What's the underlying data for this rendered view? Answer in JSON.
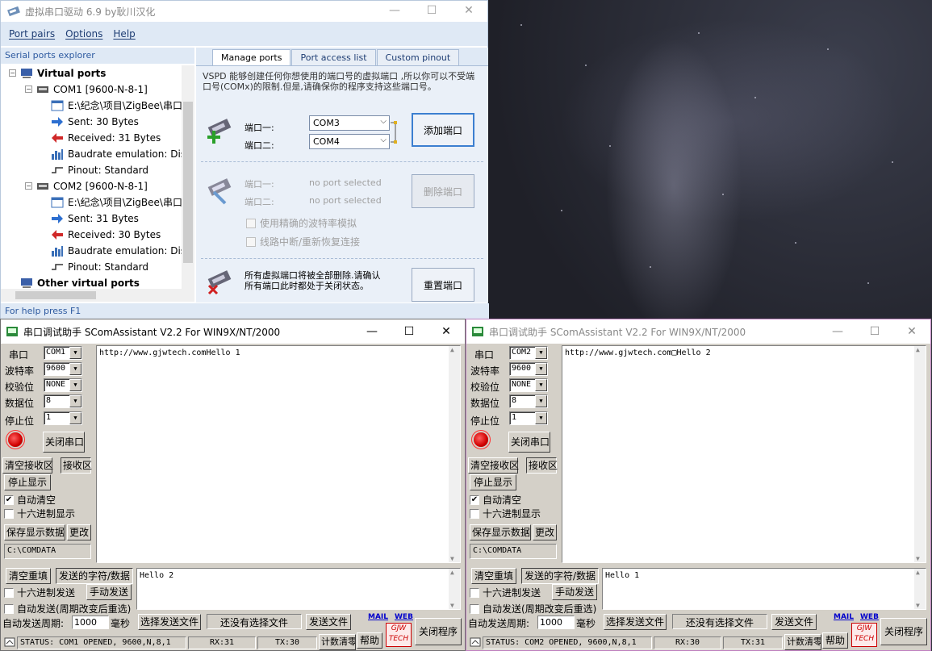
{
  "vspd": {
    "title": "虚拟串口驱动 6.9 by耿川汉化",
    "menu": [
      "Port pairs",
      "Options",
      "Help"
    ],
    "explorer_header": "Serial ports explorer",
    "tree": {
      "virtual_ports": "Virtual ports",
      "com1": "COM1 [9600-N-8-1]",
      "com1_path": "E:\\纪念\\项目\\ZigBee\\串口",
      "com1_sent": "Sent: 30 Bytes",
      "com1_received": "Received: 31 Bytes",
      "com1_baud": "Baudrate emulation: Dis",
      "com1_pinout": "Pinout: Standard",
      "com2": "COM2 [9600-N-8-1]",
      "com2_path": "E:\\纪念\\项目\\ZigBee\\串口",
      "com2_sent": "Sent: 31 Bytes",
      "com2_received": "Received: 30 Bytes",
      "com2_baud": "Baudrate emulation: Dis",
      "com2_pinout": "Pinout: Standard",
      "other_ports": "Other virtual ports"
    },
    "tabs": [
      "Manage ports",
      "Port access list",
      "Custom pinout"
    ],
    "manage": {
      "description": "VSPD 能够创建任何你想使用的端口号的虚拟端口 ,所以你可以不受端口号(COMx)的限制.但是,请确保你的程序支持这些端口号。",
      "port1_label": "端口一:",
      "port2_label": "端口二:",
      "port1_value": "COM3",
      "port2_value": "COM4",
      "add_button": "添加端口",
      "del_port1_label": "端口一:",
      "del_port2_label": "端口二:",
      "del_port1_value": "no port selected",
      "del_port2_value": "no port selected",
      "delete_button": "删除端口",
      "strict_baud": "使用精确的波特率模拟",
      "reconnect": "线路中断/重新恢复连接",
      "reset_text": "所有虚拟端口将被全部删除.请确认所有端口此时都处于关闭状态。",
      "reset_button": "重置端口"
    },
    "status": "For help press F1"
  },
  "scom1": {
    "title": "串口调试助手 SComAssistant V2.2 For WIN9X/NT/2000",
    "port_label": "串口",
    "port_value": "COM1",
    "baud_label": "波特率",
    "baud_value": "9600",
    "parity_label": "校验位",
    "parity_value": "NONE",
    "databits_label": "数据位",
    "databits_value": "8",
    "stopbits_label": "停止位",
    "stopbits_value": "1",
    "close_port": "关闭串口",
    "clear_rx": "清空接收区",
    "rx_area": "接收区",
    "stop_display": "停止显示",
    "auto_clear": "自动清空",
    "hex_display": "十六进制显示",
    "save_data": "保存显示数据",
    "change": "更改",
    "path": "C:\\COMDATA",
    "receive_text": "http://www.gjwtech.comHello 1",
    "clear_refill": "清空重填",
    "send_chars": "发送的字符/数据",
    "send_text": "Hello 2",
    "hex_send": "十六进制发送",
    "manual_send": "手动发送",
    "auto_send": "自动发送(周期改变后重选)",
    "period_label": "自动发送周期:",
    "period_value": "1000",
    "ms": "毫秒",
    "choose_file": "选择发送文件",
    "no_file": "还没有选择文件",
    "send_file": "发送文件",
    "mail": "MAIL",
    "web": "WEB",
    "logo1": "GJW",
    "logo2": "TECH",
    "close_program": "关闭程序",
    "status": "STATUS: COM1 OPENED, 9600,N,8,1",
    "rx": "RX:31",
    "tx": "TX:30",
    "count_clear": "计数清零",
    "help": "帮助"
  },
  "scom2": {
    "title": "串口调试助手 SComAssistant V2.2 For WIN9X/NT/2000",
    "port_label": "串口",
    "port_value": "COM2",
    "baud_label": "波特率",
    "baud_value": "9600",
    "parity_label": "校验位",
    "parity_value": "NONE",
    "databits_label": "数据位",
    "databits_value": "8",
    "stopbits_label": "停止位",
    "stopbits_value": "1",
    "close_port": "关闭串口",
    "clear_rx": "清空接收区",
    "rx_area": "接收区",
    "stop_display": "停止显示",
    "auto_clear": "自动清空",
    "hex_display": "十六进制显示",
    "save_data": "保存显示数据",
    "change": "更改",
    "path": "C:\\COMDATA",
    "receive_text": "http://www.gjwtech.com□Hello 2",
    "clear_refill": "清空重填",
    "send_chars": "发送的字符/数据",
    "send_text": "Hello 1",
    "hex_send": "十六进制发送",
    "manual_send": "手动发送",
    "auto_send": "自动发送(周期改变后重选)",
    "period_label": "自动发送周期:",
    "period_value": "1000",
    "ms": "毫秒",
    "choose_file": "选择发送文件",
    "no_file": "还没有选择文件",
    "send_file": "发送文件",
    "mail": "MAIL",
    "web": "WEB",
    "logo1": "GJW",
    "logo2": "TECH",
    "close_program": "关闭程序",
    "status": "STATUS: COM2 OPENED, 9600,N,8,1",
    "rx": "RX:30",
    "tx": "TX:31",
    "count_clear": "计数清零",
    "help": "帮助"
  }
}
